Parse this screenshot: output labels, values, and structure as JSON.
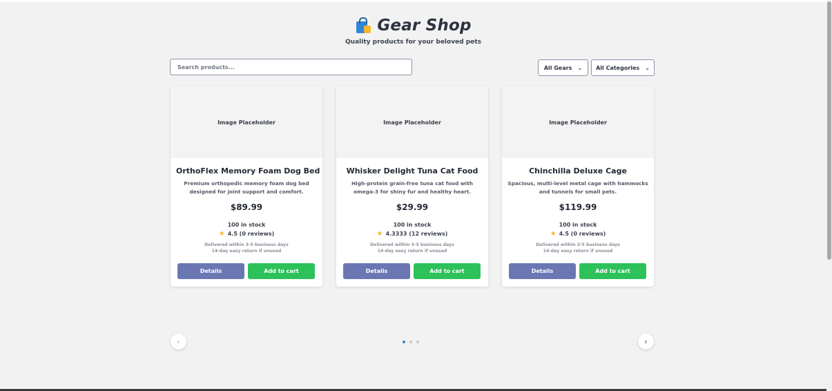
{
  "header": {
    "title": "Gear Shop",
    "subtitle": "Quality products for your beloved pets",
    "logo_icon": "shopping-bag-icon"
  },
  "search": {
    "placeholder": "Search products..."
  },
  "filters": {
    "gears": {
      "selected": "All Gears"
    },
    "categories": {
      "selected": "All Categories"
    }
  },
  "products": [
    {
      "image_label": "Image Placeholder",
      "name": "OrthoFlex Memory Foam Dog Bed",
      "description": "Premium orthopedic memory foam dog bed designed for joint support and comfort.",
      "price": "$89.99",
      "stock": "100 in stock",
      "rating": "4.5 (0 reviews)",
      "delivery": "Delivered within 3-5 business days",
      "returns": "14-day easy return if unused",
      "details_label": "Details",
      "cart_label": "Add to cart"
    },
    {
      "image_label": "Image Placeholder",
      "name": "Whisker Delight Tuna Cat Food",
      "description": "High-protein grain-free tuna cat food with omega-3 for shiny fur and healthy heart.",
      "price": "$29.99",
      "stock": "100 in stock",
      "rating": "4.3333 (12 reviews)",
      "delivery": "Delivered within 3-5 business days",
      "returns": "14-day easy return if unused",
      "details_label": "Details",
      "cart_label": "Add to cart"
    },
    {
      "image_label": "Image Placeholder",
      "name": "Chinchilla Deluxe Cage",
      "description": "Spacious, multi-level metal cage with hammocks and tunnels for small pets.",
      "price": "$119.99",
      "stock": "100 in stock",
      "rating": "4.5 (0 reviews)",
      "delivery": "Delivered within 3-5 business days",
      "returns": "14-day easy return if unused",
      "details_label": "Details",
      "cart_label": "Add to cart"
    }
  ],
  "carousel": {
    "prev_icon": "chevron-left-icon",
    "next_icon": "chevron-right-icon",
    "prev_glyph": "‹",
    "next_glyph": "›",
    "page_count": 3,
    "active_page": 1
  },
  "colors": {
    "details_button": "#6b77b3",
    "cart_button": "#2dc15a",
    "active_dot": "#2f86d6",
    "star": "#f5b72e"
  }
}
